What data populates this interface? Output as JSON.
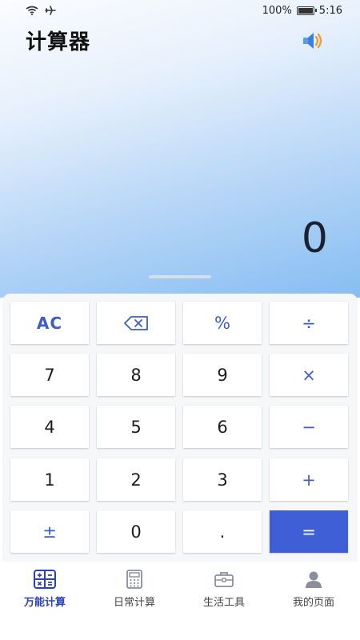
{
  "status_bar": {
    "battery": "100%",
    "time": "5:16"
  },
  "app": {
    "title": "计算器"
  },
  "display": {
    "value": "0"
  },
  "keys": {
    "ac": "AC",
    "percent": "%",
    "divide": "÷",
    "seven": "7",
    "eight": "8",
    "nine": "9",
    "multiply": "×",
    "four": "4",
    "five": "5",
    "six": "6",
    "minus": "−",
    "one": "1",
    "two": "2",
    "three": "3",
    "plus": "+",
    "plus_minus": "±",
    "zero": "0",
    "decimal": ".",
    "equals": "="
  },
  "tabs": [
    {
      "label": "万能计算",
      "icon": "calculator-grid-icon",
      "active": true
    },
    {
      "label": "日常计算",
      "icon": "calculator-icon",
      "active": false
    },
    {
      "label": "生活工具",
      "icon": "briefcase-icon",
      "active": false
    },
    {
      "label": "我的页面",
      "icon": "user-icon",
      "active": false
    }
  ],
  "colors": {
    "accent": "#3f5fd6",
    "operator": "#3d5cc9",
    "active_tab": "#2c43b8"
  }
}
